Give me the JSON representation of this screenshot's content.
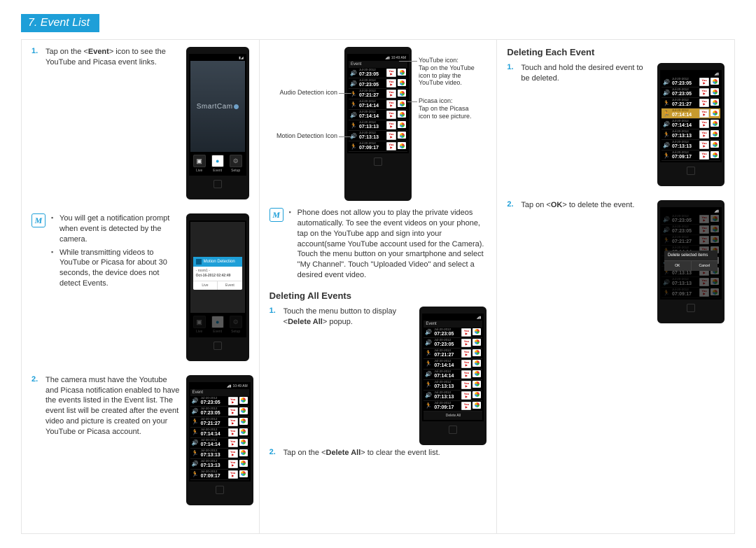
{
  "chapter": {
    "title": "7. Event List"
  },
  "col1": {
    "step1": {
      "num": "1.",
      "text_a": "Tap on the <",
      "text_b": "Event",
      "text_c": "> icon to see the YouTube and Picasa event links."
    },
    "note1": {
      "b1": "You will get a notification prompt when event is detected by the camera.",
      "b2": "While transmitting videos to YouTube or Picasa for about 30 seconds, the device does not detect Events."
    },
    "step2": {
      "num": "2.",
      "text": "The camera must have the Youtube and Picasa notification enabled to have the events listed in the Event list. The event list will be created after the event video and picture is created on your YouTube or Picasa account."
    },
    "phone_home": {
      "logo": "SmartCam",
      "live": "Live",
      "event": "Event",
      "setup": "Setup"
    },
    "phone_popup": {
      "header": "Motion Detection",
      "sub": "- room1 -",
      "date": "Oct-16-2012 02:42:49",
      "btn_live": "Live",
      "btn_event": "Event"
    },
    "room": "room1",
    "status_time": "10:49 AM"
  },
  "col2": {
    "annot": {
      "audio": "Audio Detection icon",
      "motion": "Motion Detection Icon",
      "youtube_t": "YouTube icon:",
      "youtube_d": "Tap on the YouTube icon to play the YouTube video.",
      "picasa_t": "Picasa icon:",
      "picasa_d": "Tap on the Picasa icon to see picture."
    },
    "note": "Phone does not allow you to play the private videos automatically. To see the event videos on your phone, tap on the YouTube app and sign into your account(same YouTube account used for the Camera). Touch the menu button on your smartphone and select \"My Channel\". Touch \"Uploaded Video\" and select a desired event video.",
    "sec_all": "Deleting All Events",
    "all_s1": {
      "num": "1.",
      "a": "Touch the menu button to display <",
      "b": "Delete All",
      "c": "> popup."
    },
    "all_s2": {
      "num": "2.",
      "a": "Tap on the <",
      "b": "Delete All",
      "c": "> to clear the event list."
    },
    "delete_all_bar": "Delete All",
    "ev_header": "Event"
  },
  "col3": {
    "sec_each": "Deleting Each Event",
    "each_s1": {
      "num": "1.",
      "text": "Touch and hold the desired event to be deleted."
    },
    "each_s2": {
      "num": "2.",
      "a": "Tap on <",
      "b": "OK",
      "c": "> to delete the event."
    },
    "dialog": {
      "title": "Delete selected items",
      "ok": "OK",
      "cancel": "Cancel"
    }
  },
  "events": [
    {
      "type": "audio",
      "date": "Jul-20-2012",
      "time": "07:23:05"
    },
    {
      "type": "audio",
      "date": "Jul-20-2012",
      "time": "07:23:05"
    },
    {
      "type": "motion",
      "date": "Jul-20-2012",
      "time": "07:21:27"
    },
    {
      "type": "motion",
      "date": "Jul-20-2012",
      "time": "07:14:14"
    },
    {
      "type": "audio",
      "date": "Jul-20-2012",
      "time": "07:14:14"
    },
    {
      "type": "motion",
      "date": "Jul-20-2012",
      "time": "07:13:13"
    },
    {
      "type": "audio",
      "date": "Jul-20-2012",
      "time": "07:13:13"
    },
    {
      "type": "motion",
      "date": "Jul-20-2012",
      "time": "07:09:17"
    }
  ],
  "events_hl_index": 3
}
